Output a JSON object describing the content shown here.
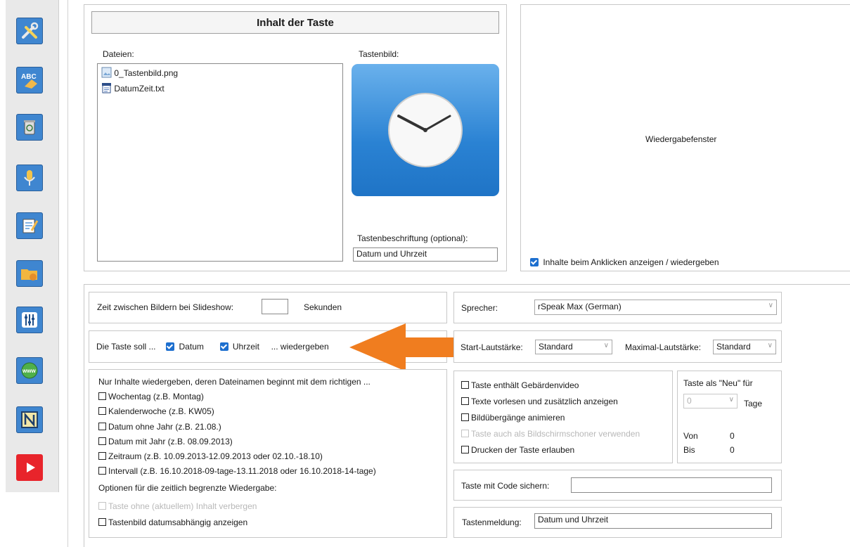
{
  "content_panel": {
    "title": "Inhalt der Taste",
    "files_label": "Dateien:",
    "files": [
      {
        "name": "0_Tastenbild.png",
        "icon": "image-file-icon"
      },
      {
        "name": "DatumZeit.txt",
        "icon": "text-file-icon"
      }
    ],
    "image_label": "Tastenbild:",
    "caption_label": "Tastenbeschriftung (optional):",
    "caption_value": "Datum und Uhrzeit"
  },
  "playback": {
    "title": "Wiedergabefenster",
    "show_on_click_label": "Inhalte beim Anklicken anzeigen / wiedergeben",
    "show_on_click_checked": true
  },
  "sidebar": {
    "buttons": [
      {
        "name": "tools-icon",
        "color": "#3f86d0"
      },
      {
        "name": "abc-eraser-icon",
        "color": "#3f86d0"
      },
      {
        "name": "trash-bin-icon",
        "color": "#3f86d0"
      },
      {
        "name": "microphone-icon",
        "color": "#3f86d0"
      },
      {
        "name": "edit-document-icon",
        "color": "#3f86d0"
      },
      {
        "name": "folder-hand-icon",
        "color": "#3f86d0"
      },
      {
        "name": "equalizer-icon",
        "color": "#3f86d0"
      },
      {
        "name": "globe-www-icon",
        "color": "#3f86d0"
      },
      {
        "name": "n-logo-icon",
        "color": "#3f86d0"
      },
      {
        "name": "youtube-icon",
        "color": "#e8242b"
      }
    ]
  },
  "slideshow": {
    "label": "Zeit zwischen Bildern bei Slideshow:",
    "value": "",
    "unit": "Sekunden"
  },
  "taste_soll": {
    "prefix": "Die Taste soll ...",
    "datum_label": "Datum",
    "uhrzeit_label": "Uhrzeit",
    "suffix": "... wiedergeben"
  },
  "filename_filter": {
    "heading": "Nur Inhalte wiedergeben, deren Dateinamen beginnt mit dem richtigen ...",
    "options": [
      "Wochentag (z.B. Montag)",
      "Kalenderwoche (z.B. KW05)",
      "Datum ohne Jahr (z.B. 21.08.)",
      "Datum mit Jahr (z.B. 08.09.2013)",
      "Zeitraum (z.B. 10.09.2013-12.09.2013 oder 02.10.-18.10)",
      "Intervall (z.B. 16.10.2018-09-tage-13.11.2018 oder 16.10.2018-14-tage)"
    ],
    "options_heading": "Optionen für die zeitlich begrenzte Wiedergabe:",
    "hide_empty_label": "Taste ohne (aktuellem) Inhalt verbergen",
    "date_dependent_label": "Tastenbild datumsabhängig anzeigen"
  },
  "speaker": {
    "label": "Sprecher:",
    "value": "rSpeak Max (German)"
  },
  "volume": {
    "start_label": "Start-Lautstärke:",
    "start_value": "Standard",
    "max_label": "Maximal-Lautstärke:",
    "max_value": "Standard"
  },
  "checkbox_options": [
    {
      "label": "Taste enthält Gebärdenvideo",
      "disabled": false
    },
    {
      "label": "Texte vorlesen und zusätzlich anzeigen",
      "disabled": false
    },
    {
      "label": "Bildübergänge animieren",
      "disabled": false
    },
    {
      "label": "Taste auch als Bildschirmschoner verwenden",
      "disabled": true
    },
    {
      "label": "Drucken der Taste erlauben",
      "disabled": false
    }
  ],
  "neu": {
    "title": "Taste als \"Neu\" für",
    "days_value": "0",
    "days_unit": "Tage",
    "von_label": "Von",
    "von_value": "0",
    "bis_label": "Bis",
    "bis_value": "0"
  },
  "code": {
    "label": "Taste mit Code sichern:",
    "value": ""
  },
  "message": {
    "label": "Tastenmeldung:",
    "value": "Datum und Uhrzeit"
  },
  "colors": {
    "accent": "#1d6fcf",
    "arrow": "#f07d1f",
    "sidebar_button": "#3f86d0"
  }
}
